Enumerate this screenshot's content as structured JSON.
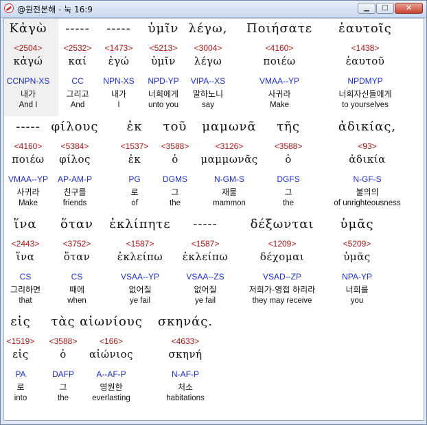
{
  "window": {
    "title": "@원전본해 - 눅 16:9",
    "min_label": "▁",
    "max_label": "□",
    "close_label": "✕"
  },
  "rows": [
    {
      "words": [
        {
          "greek": "Κἀγὼ",
          "strong": "<2504>",
          "lemma": "κἀγώ",
          "parse": "CCNPN-XS",
          "korean": "내가",
          "english": "And I"
        },
        {
          "greek": "-----",
          "strong": "<2532>",
          "lemma": "καί",
          "parse": "CC",
          "korean": "그리고",
          "english": "And"
        },
        {
          "greek": "-----",
          "strong": "<1473>",
          "lemma": "ἐγώ",
          "parse": "NPN-XS",
          "korean": "내가",
          "english": "I"
        },
        {
          "greek": "ὑμῖν",
          "strong": "<5213>",
          "lemma": "ὑμῖν",
          "parse": "NPD-YP",
          "korean": "너희에게",
          "english": "unto you"
        },
        {
          "greek": "λέγω,",
          "strong": "<3004>",
          "lemma": "λέγω",
          "parse": "VIPA--XS",
          "korean": "말하노니",
          "english": "say"
        },
        {
          "greek": "Ποιήσατε",
          "strong": "<4160>",
          "lemma": "ποιέω",
          "parse": "VMAA--YP",
          "korean": "사귀라",
          "english": "Make"
        },
        {
          "greek": "ἑαυτοῖς",
          "strong": "<1438>",
          "lemma": "ἑαυτοῦ",
          "parse": "NPDMYP",
          "korean": "너희자신들에게",
          "english": "to yourselves"
        }
      ]
    },
    {
      "words": [
        {
          "greek": "-----",
          "strong": "<4160>",
          "lemma": "ποιέω",
          "parse": "VMAA--YP",
          "korean": "사귀라",
          "english": "Make"
        },
        {
          "greek": "φίλους",
          "strong": "<5384>",
          "lemma": "φίλος",
          "parse": "AP-AM-P",
          "korean": "친구를",
          "english": "friends"
        },
        {
          "greek": "ἐκ",
          "strong": "<1537>",
          "lemma": "ἐκ",
          "parse": "PG",
          "korean": "로",
          "english": "of"
        },
        {
          "greek": "τοῦ",
          "strong": "<3588>",
          "lemma": "ὁ",
          "parse": "DGMS",
          "korean": "그",
          "english": "the"
        },
        {
          "greek": "μαμωνᾶ",
          "strong": "<3126>",
          "lemma": "μαμμωνᾶς",
          "parse": "N-GM-S",
          "korean": "재물",
          "english": "mammon"
        },
        {
          "greek": "τῆς",
          "strong": "<3588>",
          "lemma": "ὁ",
          "parse": "DGFS",
          "korean": "그",
          "english": "the"
        },
        {
          "greek": "ἀδικίας,",
          "strong": "<93>",
          "lemma": "ἀδικία",
          "parse": "N-GF-S",
          "korean": "불의의",
          "english": "of unrighteousness"
        }
      ]
    },
    {
      "words": [
        {
          "greek": "ἵνα",
          "strong": "<2443>",
          "lemma": "ἵνα",
          "parse": "CS",
          "korean": "그리하면",
          "english": "that"
        },
        {
          "greek": "ὅταν",
          "strong": "<3752>",
          "lemma": "ὅταν",
          "parse": "CS",
          "korean": "때에",
          "english": "when"
        },
        {
          "greek": "ἐκλίπητε",
          "strong": "<1587>",
          "lemma": "ἐκλείπω",
          "parse": "VSAA--YP",
          "korean": "없어질",
          "english": "ye fail"
        },
        {
          "greek": "-----",
          "strong": "<1587>",
          "lemma": "ἐκλείπω",
          "parse": "VSAA--ZS",
          "korean": "없어질",
          "english": "ye fail"
        },
        {
          "greek": "δέξωνται",
          "strong": "<1209>",
          "lemma": "δέχομαι",
          "parse": "VSAD--ZP",
          "korean": "저희가-영접 하리라",
          "english": "they may receive"
        },
        {
          "greek": "ὑμᾶς",
          "strong": "<5209>",
          "lemma": "ὑμᾶς",
          "parse": "NPA-YP",
          "korean": "너희를",
          "english": "you"
        }
      ]
    },
    {
      "words": [
        {
          "greek": "εἰς",
          "strong": "<1519>",
          "lemma": "εἰς",
          "parse": "PA",
          "korean": "로",
          "english": "into"
        },
        {
          "greek": "τὰς",
          "strong": "<3588>",
          "lemma": "ὁ",
          "parse": "DAFP",
          "korean": "그",
          "english": "the"
        },
        {
          "greek": "αἰωνίους",
          "strong": "<166>",
          "lemma": "αἰώνιος",
          "parse": "A--AF-P",
          "korean": "영원한",
          "english": "everlasting"
        },
        {
          "greek": "σκηνάς.",
          "strong": "<4633>",
          "lemma": "σκηνή",
          "parse": "N-AF-P",
          "korean": "처소",
          "english": "habitations"
        }
      ]
    }
  ]
}
